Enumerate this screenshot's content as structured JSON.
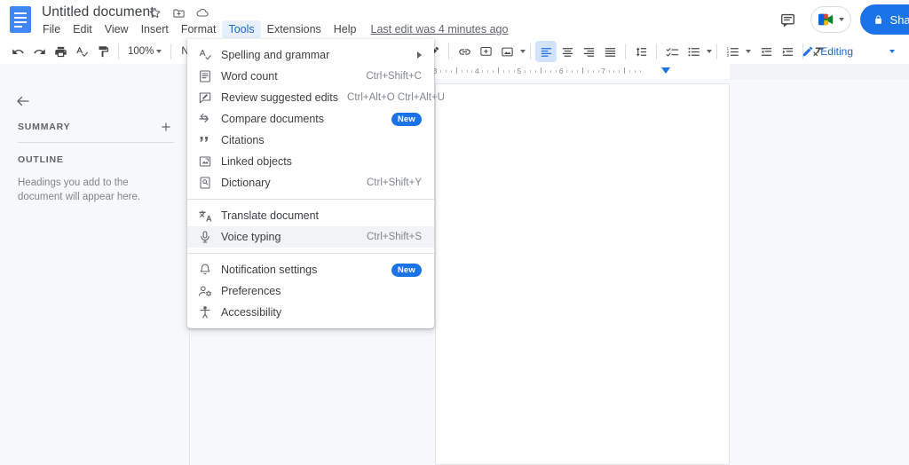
{
  "app": {
    "name": "Google Docs",
    "logo_icon": "docs-file-icon"
  },
  "titlebar": {
    "document_title": "Untitled document",
    "icons": [
      {
        "name": "star-icon",
        "label": "Star"
      },
      {
        "name": "move-to-folder-icon",
        "label": "Move"
      },
      {
        "name": "cloud-saved-icon",
        "label": "Saved to Drive"
      }
    ],
    "menus": [
      {
        "label": "File",
        "active": false
      },
      {
        "label": "Edit",
        "active": false
      },
      {
        "label": "View",
        "active": false
      },
      {
        "label": "Insert",
        "active": false
      },
      {
        "label": "Format",
        "active": false
      },
      {
        "label": "Tools",
        "active": true
      },
      {
        "label": "Extensions",
        "active": false
      },
      {
        "label": "Help",
        "active": false
      }
    ],
    "last_edit": "Last edit was 4 minutes ago",
    "comment_icon": "comment-history-icon",
    "meet_icon": "google-meet-icon",
    "share_label": "Shar",
    "share_lock_icon": "lock-icon"
  },
  "toolbar": {
    "zoom_level": "100%",
    "style_name": "Normal",
    "editing_mode": "Editing",
    "editing_icon": "pencil-icon",
    "buttons": [
      {
        "name": "undo-button",
        "icon": "undo-icon"
      },
      {
        "name": "redo-button",
        "icon": "redo-icon"
      },
      {
        "name": "print-button",
        "icon": "print-icon"
      },
      {
        "name": "spelling-check-button",
        "icon": "spellcheck-icon"
      },
      {
        "name": "paint-format-button",
        "icon": "paint-format-icon"
      },
      {
        "name": "edit-highlight-button",
        "icon": "pen-icon"
      },
      {
        "name": "insert-link-button",
        "icon": "link-icon"
      },
      {
        "name": "add-comment-button",
        "icon": "comment-plus-icon"
      },
      {
        "name": "insert-image-button",
        "icon": "image-icon"
      },
      {
        "name": "align-left-button",
        "icon": "align-left-icon"
      },
      {
        "name": "align-center-button",
        "icon": "align-center-icon"
      },
      {
        "name": "align-right-button",
        "icon": "align-right-icon"
      },
      {
        "name": "align-justify-button",
        "icon": "align-justify-icon"
      },
      {
        "name": "line-spacing-button",
        "icon": "line-spacing-icon"
      },
      {
        "name": "checklist-button",
        "icon": "checklist-icon"
      },
      {
        "name": "bulleted-list-button",
        "icon": "bulleted-list-icon"
      },
      {
        "name": "numbered-list-button",
        "icon": "numbered-list-icon"
      },
      {
        "name": "decrease-indent-button",
        "icon": "decrease-indent-icon"
      },
      {
        "name": "increase-indent-button",
        "icon": "increase-indent-icon"
      },
      {
        "name": "clear-formatting-button",
        "icon": "clear-formatting-icon"
      }
    ]
  },
  "ruler": {
    "numbers": [
      "3",
      "4",
      "5",
      "6",
      "7"
    ],
    "indent_marker": "indent-marker"
  },
  "sidebar": {
    "back_icon": "back-arrow-icon",
    "summary_label": "SUMMARY",
    "add_summary_icon": "plus-icon",
    "outline_label": "OUTLINE",
    "outline_hint": "Headings you add to the document will appear here."
  },
  "tools_menu": {
    "groups": [
      {
        "items": [
          {
            "label": "Spelling and grammar",
            "icon": "spellcheck-icon",
            "accel": "",
            "submenu": true,
            "badge": "",
            "highlighted": false
          },
          {
            "label": "Word count",
            "icon": "word-count-icon",
            "accel": "Ctrl+Shift+C",
            "submenu": false,
            "badge": "",
            "highlighted": false
          },
          {
            "label": "Review suggested edits",
            "icon": "review-edits-icon",
            "accel": "Ctrl+Alt+O Ctrl+Alt+U",
            "submenu": false,
            "badge": "",
            "highlighted": false
          },
          {
            "label": "Compare documents",
            "icon": "compare-documents-icon",
            "accel": "",
            "submenu": false,
            "badge": "New",
            "highlighted": false
          },
          {
            "label": "Citations",
            "icon": "citations-icon",
            "accel": "",
            "submenu": false,
            "badge": "",
            "highlighted": false
          },
          {
            "label": "Linked objects",
            "icon": "linked-objects-icon",
            "accel": "",
            "submenu": false,
            "badge": "",
            "highlighted": false
          },
          {
            "label": "Dictionary",
            "icon": "dictionary-icon",
            "accel": "Ctrl+Shift+Y",
            "submenu": false,
            "badge": "",
            "highlighted": false
          }
        ]
      },
      {
        "items": [
          {
            "label": "Translate document",
            "icon": "translate-icon",
            "accel": "",
            "submenu": false,
            "badge": "",
            "highlighted": false
          },
          {
            "label": "Voice typing",
            "icon": "microphone-icon",
            "accel": "Ctrl+Shift+S",
            "submenu": false,
            "badge": "",
            "highlighted": true
          }
        ]
      },
      {
        "items": [
          {
            "label": "Notification settings",
            "icon": "bell-icon",
            "accel": "",
            "submenu": false,
            "badge": "New",
            "highlighted": false
          },
          {
            "label": "Preferences",
            "icon": "preferences-icon",
            "accel": "",
            "submenu": false,
            "badge": "",
            "highlighted": false
          },
          {
            "label": "Accessibility",
            "icon": "accessibility-icon",
            "accel": "",
            "submenu": false,
            "badge": "",
            "highlighted": false
          }
        ]
      }
    ]
  },
  "colors": {
    "accent_blue": "#1a73e8",
    "menu_active_bg": "#e8f0fe",
    "menu_active_text": "#1967d2",
    "hover_gray": "#f1f3f4",
    "canvas_bg": "#f6f8fa",
    "text_primary": "#3c4043",
    "text_secondary": "#5f6368"
  }
}
